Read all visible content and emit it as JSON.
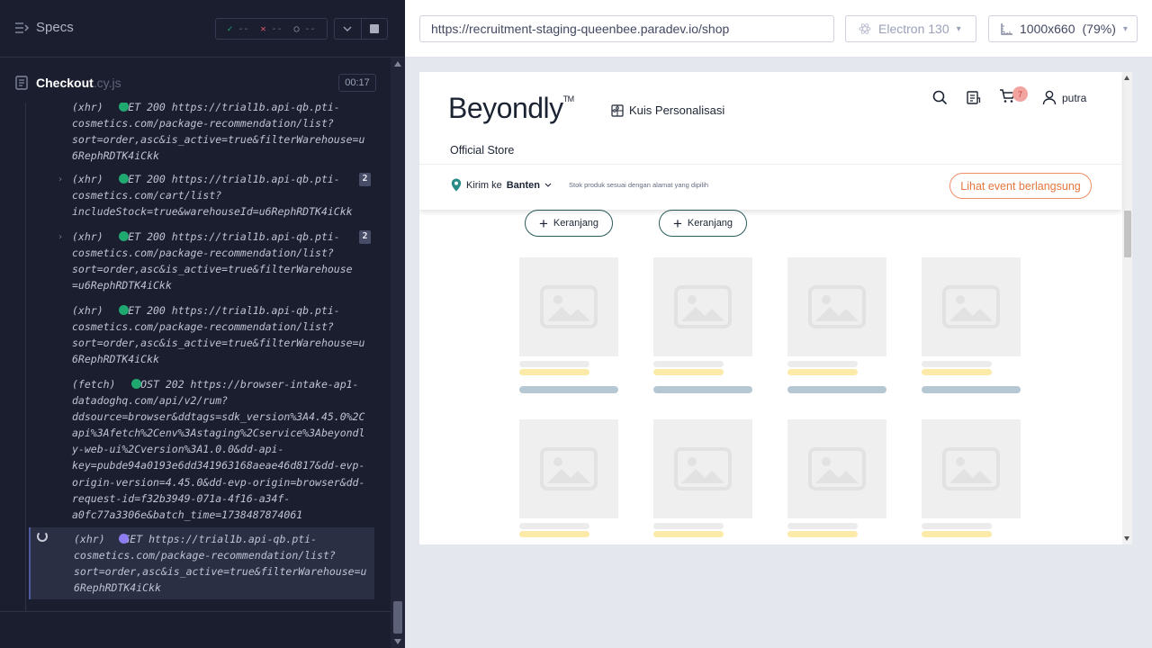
{
  "sidebar": {
    "specs_label": "Specs",
    "stats": {
      "passed": "--",
      "failed": "--",
      "pending": "--"
    },
    "spec": {
      "name": "Checkout",
      "ext": ".cy.js",
      "duration": "00:17"
    },
    "log_entries": [
      {
        "lines": "(xhr)   GET 200 https://trial1b.api-qb.pti-\ncosmetics.com/package-recommendation/list?\nsort=order,asc&is_active=true&filterWarehouse=u\n6RephRDTK4iCkk",
        "count": ""
      },
      {
        "lines": "(xhr)   GET 200 https://trial1b.api-qb.pti-\ncosmetics.com/cart/list?\nincludeStock=true&warehouseId=u6RephRDTK4iCkk",
        "count": "2"
      },
      {
        "lines": "(xhr)   GET 200 https://trial1b.api-qb.pti-\ncosmetics.com/package-recommendation/list?\nsort=order,asc&is_active=true&filterWarehouse\n=u6RephRDTK4iCkk",
        "count": "2"
      },
      {
        "lines": "(xhr)   GET 200 https://trial1b.api-qb.pti-\ncosmetics.com/package-recommendation/list?\nsort=order,asc&is_active=true&filterWarehouse=u\n6RephRDTK4iCkk",
        "count": ""
      },
      {
        "lines": "(fetch)   POST 202 https://browser-intake-ap1-\ndatadoghq.com/api/v2/rum?\nddsource=browser&ddtags=sdk_version%3A4.45.0%2C\napi%3Afetch%2Cenv%3Astaging%2Cservice%3Abeyondl\ny-web-ui%2Cversion%3A1.0.0&dd-api-\nkey=pubde94a0193e6dd341963168aeae46d817&dd-evp-\norigin-version=4.45.0&dd-evp-origin=browser&dd-\nrequest-id=f32b3949-071a-4f16-a34f-\na0fc77a3306e&batch_time=1738487874061",
        "count": ""
      },
      {
        "lines": "(xhr)   GET https://trial1b.api-qb.pti-\ncosmetics.com/package-recommendation/list?\nsort=order,asc&is_active=true&filterWarehouse=u\n6RephRDTK4iCkk",
        "count": ""
      }
    ]
  },
  "browser_bar": {
    "url": "https://recruitment-staging-queenbee.paradev.io/shop",
    "browser": "Electron 130",
    "viewport": "1000x660",
    "zoom": "(79%)"
  },
  "site": {
    "logo": "Beyondly",
    "logo_tm": "TM",
    "quiz_label": "Kuis Personalisasi",
    "cart_count": "7",
    "username": "putra",
    "official_store": "Official Store",
    "ship_prefix": "Kirim ke",
    "ship_region": "Banten",
    "ship_note": "Stok produk sesuai dengan alamat yang dipilih",
    "event_button": "Lihat event berlangsung",
    "add_to_cart": "Keranjang"
  },
  "colors": {
    "cypress_bg": "#1b1e2e",
    "pass_green": "#1fa971",
    "pending_purple": "#8d7df0",
    "accent_orange": "#e5773f",
    "brand_teal": "#2b5e5d"
  }
}
